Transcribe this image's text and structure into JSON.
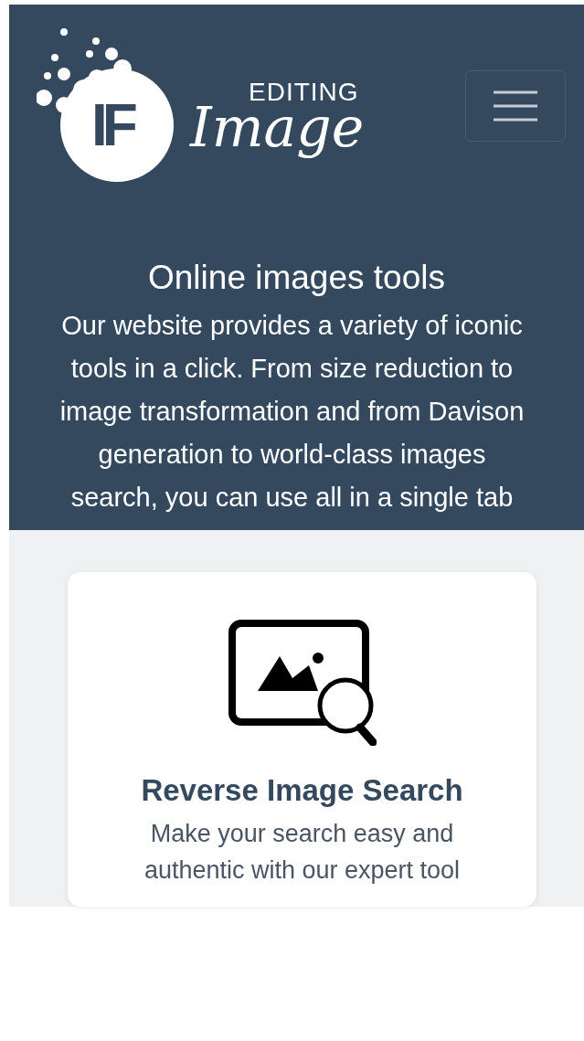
{
  "header": {
    "logo": {
      "badge": "IF",
      "word_top": "EDITING",
      "word_main": "Image"
    },
    "menu_button": {
      "expanded": false
    }
  },
  "hero": {
    "title": "Online images tools",
    "text": "Our website provides a variety of iconic tools in a click. From size reduction to image transformation and from Davison generation to world-class images search, you can use all in a single tab"
  },
  "cards": [
    {
      "title": "Reverse Image Search",
      "text": "Make your search easy and authentic with our expert tool"
    }
  ]
}
